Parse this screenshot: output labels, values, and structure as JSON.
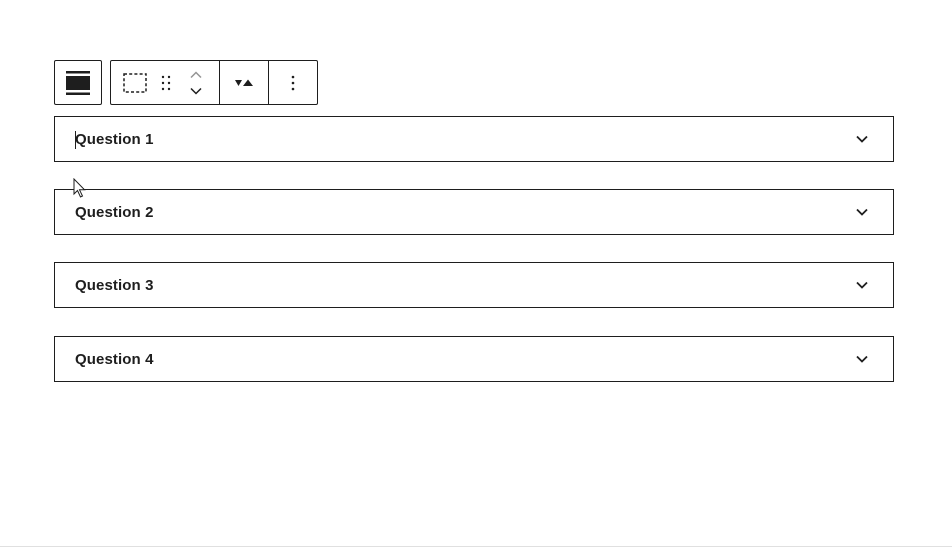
{
  "toolbar": {
    "parent_icon": "align-wide-icon",
    "select_icon": "select-block-icon",
    "drag_icon": "drag-handle-icon",
    "move_up_icon": "chevron-up-icon",
    "move_down_icon": "chevron-down-icon",
    "align_icon": "triangles-align-icon",
    "more_icon": "more-vertical-icon"
  },
  "accordion": {
    "items": [
      {
        "title": "Question 1",
        "icon": "chevron-down-icon",
        "focused": true
      },
      {
        "title": "Question 2",
        "icon": "chevron-down-icon"
      },
      {
        "title": "Question 3",
        "icon": "chevron-down-icon"
      },
      {
        "title": "Question 4",
        "icon": "chevron-down-icon"
      }
    ]
  },
  "colors": {
    "text": "#1e1e1e",
    "border": "#1e1e1e",
    "background": "#ffffff",
    "muted": "#757575"
  }
}
